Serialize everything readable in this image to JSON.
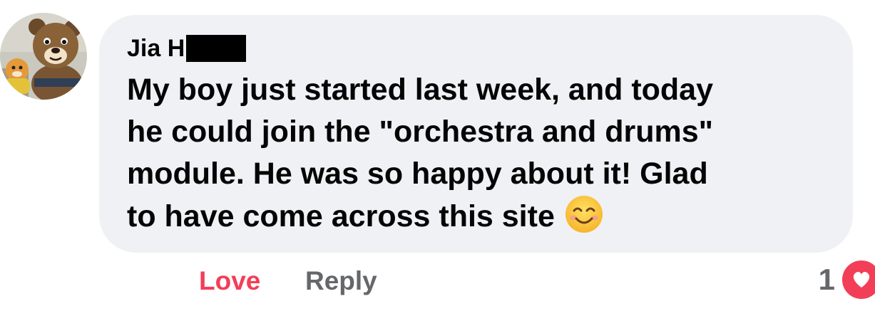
{
  "comment": {
    "author_visible": "Jia H",
    "text_lines": [
      "My boy just started last week, and today",
      "he could join the \"orchestra and drums\"",
      "module. He was so happy about it! Glad",
      "to have come across this site"
    ],
    "emoji": "smiling-face-with-smiling-eyes"
  },
  "actions": {
    "love_label": "Love",
    "reply_label": "Reply"
  },
  "reactions": {
    "count": "1",
    "type": "love-heart-icon"
  },
  "colors": {
    "bubble_bg": "#f0f1f5",
    "love_red": "#f33e58",
    "muted_gray": "#65676b",
    "text_dark": "#050505"
  }
}
